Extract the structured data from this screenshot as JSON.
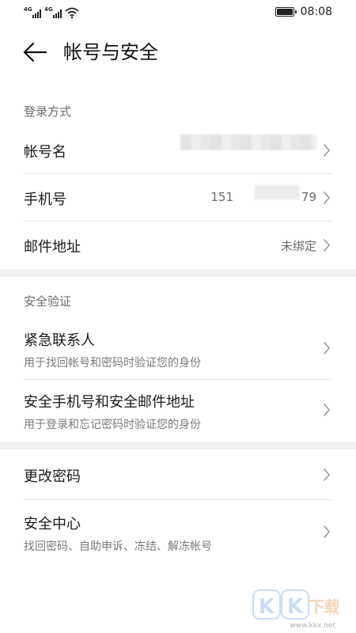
{
  "status_bar": {
    "time": "08:08",
    "signal_1_label": "4G",
    "signal_2_label": "4G",
    "icons": [
      "signal-icon",
      "signal-icon",
      "wifi-icon",
      "battery-icon"
    ]
  },
  "header": {
    "title": "帐号与安全",
    "back_icon": "arrow-left-icon"
  },
  "sections": {
    "login": {
      "label": "登录方式",
      "rows": {
        "account_name": {
          "label": "帐号名",
          "value": ""
        },
        "phone": {
          "label": "手机号",
          "value_prefix": "151",
          "value_suffix": "79"
        },
        "email": {
          "label": "邮件地址",
          "value": "未绑定"
        }
      }
    },
    "verification": {
      "label": "安全验证",
      "rows": {
        "emergency_contact": {
          "label": "紧急联系人",
          "sub": "用于找回帐号和密码时验证您的身份"
        },
        "secure_phone_email": {
          "label": "安全手机号和安全邮件地址",
          "sub": "用于登录和忘记密码时验证您的身份"
        }
      }
    },
    "other": {
      "rows": {
        "change_password": {
          "label": "更改密码"
        },
        "security_center": {
          "label": "安全中心",
          "sub": "找回密码、自助申诉、冻结、解冻帐号"
        }
      }
    }
  },
  "watermark": {
    "logo_text": "KK下载",
    "url": "www.kkx.net"
  },
  "colors": {
    "background": "#f1f1f1",
    "card": "#ffffff",
    "primary_text": "#1a1a1a",
    "secondary_text": "#7a7a7a",
    "divider": "#e6e6e6",
    "chevron": "#9a9a9a"
  }
}
